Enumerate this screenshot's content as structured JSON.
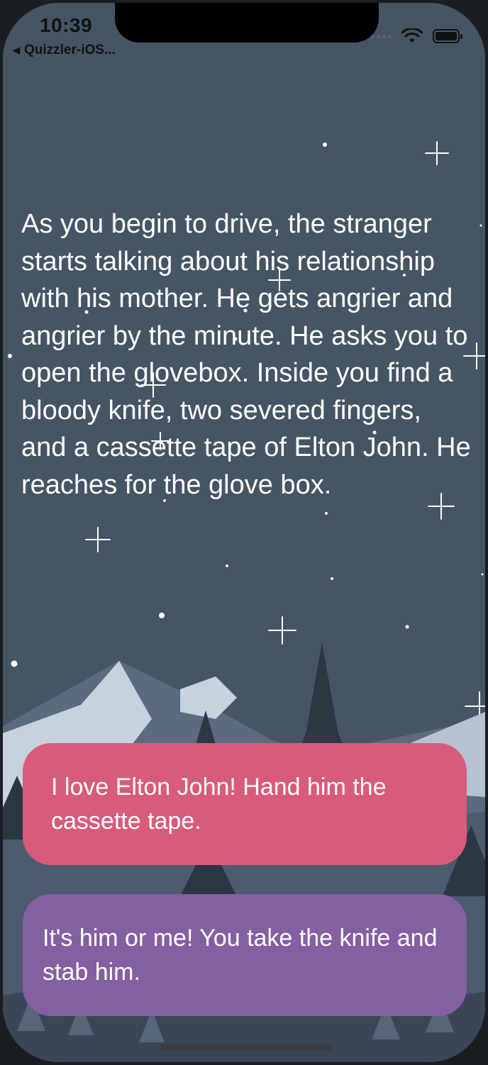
{
  "status_bar": {
    "time": "10:39",
    "back_app_label": "Quizzler-iOS..."
  },
  "story": {
    "text": "As you begin to drive, the stranger starts talking about his relationship with his mother. He gets angrier and angrier by the minute. He asks you to open the glovebox. Inside you find a bloody knife, two severed fingers, and a cassette tape of Elton John. He reaches for the glove box."
  },
  "choices": [
    {
      "label": "I love Elton John! Hand him the cassette tape."
    },
    {
      "label": "It's him or me! You take the knife and stab him."
    }
  ],
  "colors": {
    "background": "#465564",
    "choice1": "#d95b7b",
    "choice2": "#845fa2",
    "text": "#ffffff"
  },
  "icons": {
    "back": "back-triangle-icon",
    "cellular": "cellular-signal-icon",
    "wifi": "wifi-icon",
    "battery": "battery-icon"
  }
}
